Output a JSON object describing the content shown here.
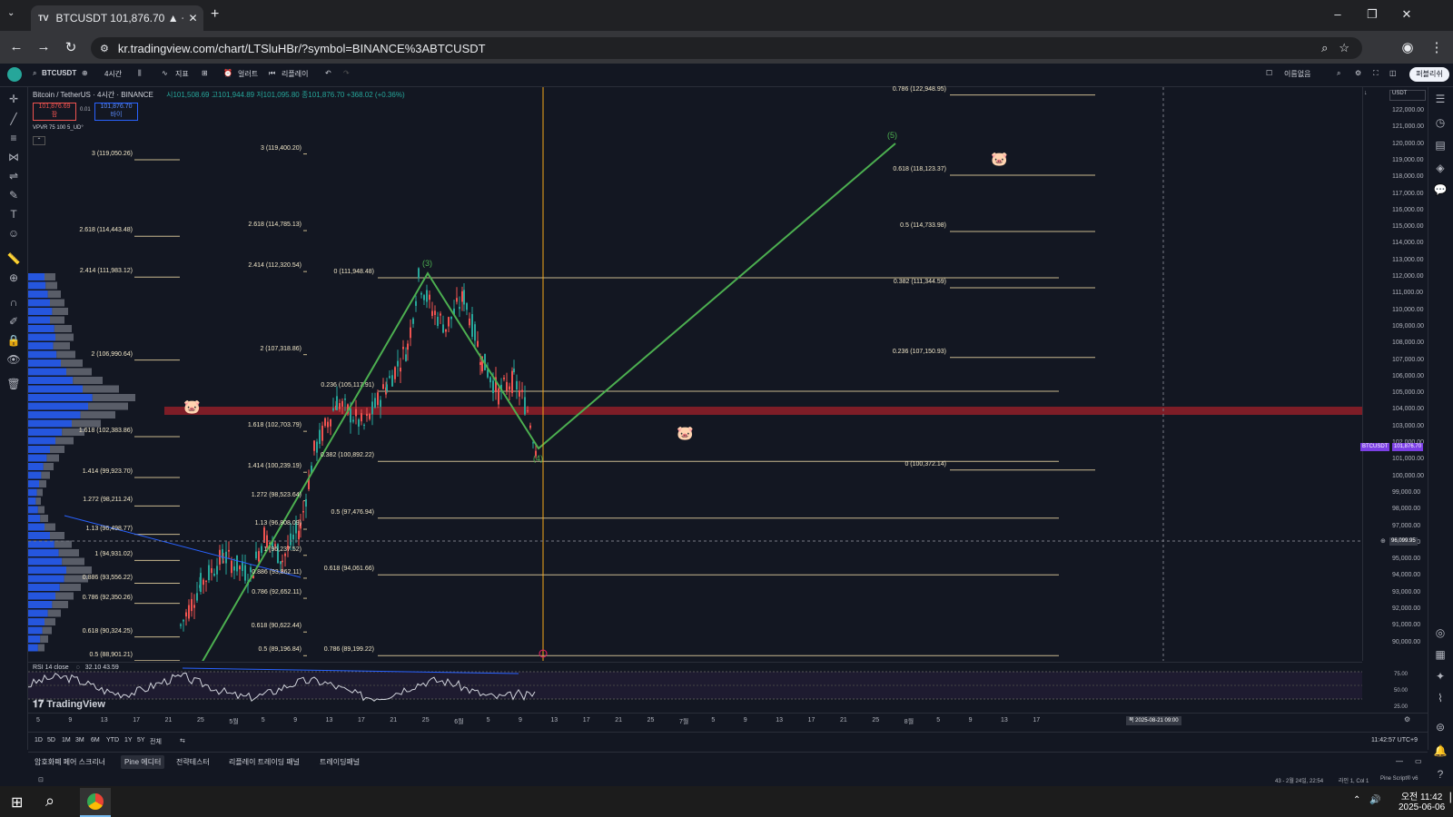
{
  "browser": {
    "tab_title": "BTCUSDT 101,876.70 ▲ +0.36",
    "tab_close": "✕",
    "new_tab": "+",
    "url": "kr.tradingview.com/chart/LTSluHBr/?symbol=BINANCE%3ABTCUSDT",
    "minimize": "–",
    "restore": "❐",
    "close": "✕"
  },
  "tv_toolbar": {
    "symbol": "BTCUSDT",
    "interval": "4시간",
    "indicators": "지표",
    "alert": "얼러트",
    "replay": "리플레이",
    "unnamed": "이름없음",
    "publish": "퍼블리쉬"
  },
  "legend": {
    "title": "Bitcoin / TetherUS · 4시간 · BINANCE",
    "ohlc": "시101,508.69 고101,944.89 저101,095.80 종101,876.70 +368.02 (+0.36%)",
    "sell_price": "101,876.69",
    "sell_label": "팜",
    "spread": "0.01",
    "buy_price": "101,876.70",
    "buy_label": "바이",
    "vpvr": "VPVR 75 100 5_UD°",
    "currency": "USDT"
  },
  "price_scale": [
    "122,000.00",
    "121,000.00",
    "120,000.00",
    "119,000.00",
    "118,000.00",
    "117,000.00",
    "116,000.00",
    "115,000.00",
    "114,000.00",
    "113,000.00",
    "112,000.00",
    "111,000.00",
    "110,000.00",
    "109,000.00",
    "108,000.00",
    "107,000.00",
    "106,000.00",
    "105,000.00",
    "104,000.00",
    "103,000.00",
    "102,000.00",
    "101,000.00",
    "100,000.00",
    "99,000.00",
    "98,000.00",
    "97,000.00",
    "96,000.00",
    "95,000.00",
    "94,000.00",
    "93,000.00",
    "92,000.00",
    "91,000.00",
    "90,000.00"
  ],
  "price_badge": {
    "symbol": "BTCUSDT",
    "price": "101,876.70"
  },
  "crosshair_price": "96,099.95",
  "fib_left": [
    "3 (119,050.26)",
    "2.618 (114,443.48)",
    "2.414 (111,983.12)",
    "2 (106,990.64)",
    "1.618 (102,383.86)",
    "1.414 (99,923.70)",
    "1.272 (98,211.24)",
    "1.13 (96,498.77)",
    "1 (94,931.02)",
    "0.886 (93,556.22)",
    "0.786 (92,350.26)",
    "0.618 (90,324.25)",
    "0.5 (88,901.21)"
  ],
  "fib_mid": [
    "3 (119,400.20)",
    "2.618 (114,785.13)",
    "2.414 (112,320.54)",
    "2 (107,318.86)",
    "1.618 (102,703.79)",
    "1.414 (100,239.19)",
    "1.272 (98,523.64)",
    "1.13 (96,808.09)",
    "1 (95,237.52)",
    "0.886 (93,862.11)",
    "0.786 (92,652.11)",
    "0.618 (90,622.44)",
    "0.5 (89,196.84)"
  ],
  "fib_retrace": [
    "0 (111,948.48)",
    "0.236 (105,117.91)",
    "0.382 (100,892.22)",
    "0.5 (97,476.94)",
    "0.618 (94,061.66)",
    "0.786 (89,199.22)"
  ],
  "fib_right": [
    "0.786 (122,948.95)",
    "0.618 (118,123.37)",
    "0.5 (114,733.98)",
    "0.382 (111,344.59)",
    "0.236 (107,150.93)",
    "0 (100,372.14)"
  ],
  "waves": [
    "(3)",
    "(4)",
    "(5)"
  ],
  "pig_icon": "🐷",
  "rsi": {
    "label": "RSI 14 close",
    "values": "32.10 43.59",
    "levels": [
      "75.00",
      "50.00",
      "25.00"
    ]
  },
  "watermark": "TradingView",
  "time_axis": [
    "5",
    "9",
    "13",
    "17",
    "21",
    "25",
    "5월",
    "5",
    "9",
    "13",
    "17",
    "21",
    "25",
    "6월",
    "5",
    "9",
    "13",
    "17",
    "21",
    "25",
    "7월",
    "5",
    "9",
    "13",
    "17",
    "21",
    "25",
    "8월",
    "5",
    "9",
    "13",
    "17"
  ],
  "time_cursor": "목 2025-08-21   09:00",
  "periods": [
    "1D",
    "5D",
    "1M",
    "3M",
    "6M",
    "YTD",
    "1Y",
    "5Y",
    "전체"
  ],
  "clock": "11:42:57 UTC+9",
  "bottom_tabs": [
    "암호화폐 페어 스크리너",
    "Pine 에디터",
    "전략테스터",
    "리플레이 트레이딩 패널",
    "트레이딩패널"
  ],
  "status": {
    "position": "43 - 2월 24일, 22:54",
    "cursor": "라인 1, Col 1",
    "script": "Pine Script® v6"
  },
  "taskbar": {
    "time": "오전 11:42",
    "date": "2025-06-06"
  },
  "colors": {
    "up": "#26a69a",
    "down": "#ef5350",
    "wave": "#4caf50",
    "fib": "#c9b98f",
    "zone": "#8b1e28",
    "volume_profile": "#2962ff"
  }
}
